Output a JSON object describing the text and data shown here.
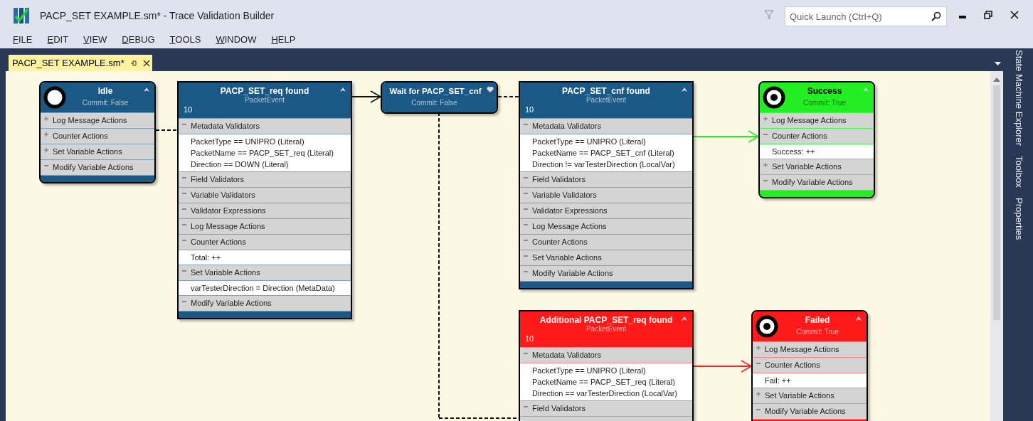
{
  "window": {
    "title": "PACP_SET EXAMPLE.sm* - Trace Validation Builder",
    "quick_launch": {
      "placeholder": "Quick Launch (Ctrl+Q)"
    }
  },
  "menu": [
    "FILE",
    "EDIT",
    "VIEW",
    "DEBUG",
    "TOOLS",
    "WINDOW",
    "HELP"
  ],
  "document_tab": {
    "label": "PACP_SET EXAMPLE.sm*",
    "selected": true
  },
  "side_panels": [
    "State Machine Explorer",
    "Toolbox",
    "Properties"
  ],
  "nodes": [
    {
      "kind": "initial_state",
      "color": "#1a5886",
      "title": "Idle",
      "subtitle": "Commit: False",
      "sections": [
        {
          "label": "Log Message Actions",
          "expanded": false
        },
        {
          "label": "Counter Actions",
          "expanded": false
        },
        {
          "label": "Set Variable Actions",
          "expanded": false
        },
        {
          "label": "Modify Variable Actions",
          "expanded": true
        }
      ]
    },
    {
      "kind": "event",
      "color": "#1a5886",
      "title": "PACP_SET_req found",
      "subtitle": "PacketEvent",
      "number": "10",
      "sections": [
        {
          "label": "Metadata Validators",
          "expanded": true,
          "lines": [
            "PacketType == UNIPRO (Literal)",
            "PacketName == PACP_SET_req (Literal)",
            "Direction == DOWN (Literal)"
          ]
        },
        {
          "label": "Field Validators",
          "expanded": true
        },
        {
          "label": "Variable Validators",
          "expanded": true
        },
        {
          "label": "Validator Expressions",
          "expanded": true
        },
        {
          "label": "Log Message Actions",
          "expanded": true
        },
        {
          "label": "Counter Actions",
          "expanded": true,
          "lines": [
            "Total: ++"
          ]
        },
        {
          "label": "Set Variable Actions",
          "expanded": true,
          "lines": [
            "varTesterDirection = Direction (MetaData)"
          ]
        },
        {
          "label": "Modify Variable Actions",
          "expanded": true
        }
      ]
    },
    {
      "kind": "compact_state",
      "color": "#1a5886",
      "title": "Wait for PACP_SET_cnf",
      "subtitle": "Commit: False"
    },
    {
      "kind": "event",
      "color": "#1a5886",
      "title": "PACP_SET_cnf found",
      "subtitle": "PacketEvent",
      "number": "10",
      "sections": [
        {
          "label": "Metadata Validators",
          "expanded": true,
          "lines": [
            "PacketType == UNIPRO (Literal)",
            "PacketName == PACP_SET_cnf (Literal)",
            "Direction != varTesterDirection (LocalVar)"
          ]
        },
        {
          "label": "Field Validators",
          "expanded": true
        },
        {
          "label": "Variable Validators",
          "expanded": true
        },
        {
          "label": "Validator Expressions",
          "expanded": true
        },
        {
          "label": "Log Message Actions",
          "expanded": true
        },
        {
          "label": "Counter Actions",
          "expanded": true
        },
        {
          "label": "Set Variable Actions",
          "expanded": true
        },
        {
          "label": "Modify Variable Actions",
          "expanded": true
        }
      ]
    },
    {
      "kind": "final_state",
      "color": "#22ee22",
      "title": "Success",
      "subtitle": "Commit: True",
      "sections": [
        {
          "label": "Log Message Actions",
          "expanded": false
        },
        {
          "label": "Counter Actions",
          "expanded": true,
          "lines": [
            "Success: ++"
          ]
        },
        {
          "label": "Set Variable Actions",
          "expanded": false
        },
        {
          "label": "Modify Variable Actions",
          "expanded": true
        }
      ]
    },
    {
      "kind": "event",
      "color": "#ff1a1a",
      "title": "Additional PACP_SET_req found",
      "subtitle": "PacketEvent",
      "number": "10",
      "sections": [
        {
          "label": "Metadata Validators",
          "expanded": true,
          "lines": [
            "PacketType == UNIPRO (Literal)",
            "PacketName == PACP_SET_req (Literal)",
            "Direction == varTesterDirection (LocalVar)"
          ]
        },
        {
          "label": "Field Validators",
          "expanded": true
        }
      ]
    },
    {
      "kind": "final_state",
      "color": "#ff1a1a",
      "title": "Failed",
      "subtitle": "Commit: True",
      "sections": [
        {
          "label": "Log Message Actions",
          "expanded": false
        },
        {
          "label": "Counter Actions",
          "expanded": true,
          "lines": [
            "Fail: ++"
          ]
        },
        {
          "label": "Set Variable Actions",
          "expanded": false
        },
        {
          "label": "Modify Variable Actions",
          "expanded": true
        }
      ]
    }
  ],
  "edges": [
    {
      "kind": "dashed",
      "color": "#111111"
    },
    {
      "kind": "arrow",
      "color": "#111111"
    },
    {
      "kind": "dashed",
      "color": "#111111"
    },
    {
      "kind": "dashed",
      "color": "#111111"
    },
    {
      "kind": "arrow",
      "color": "#22ee22"
    },
    {
      "kind": "arrow",
      "color": "#ff2020"
    }
  ]
}
